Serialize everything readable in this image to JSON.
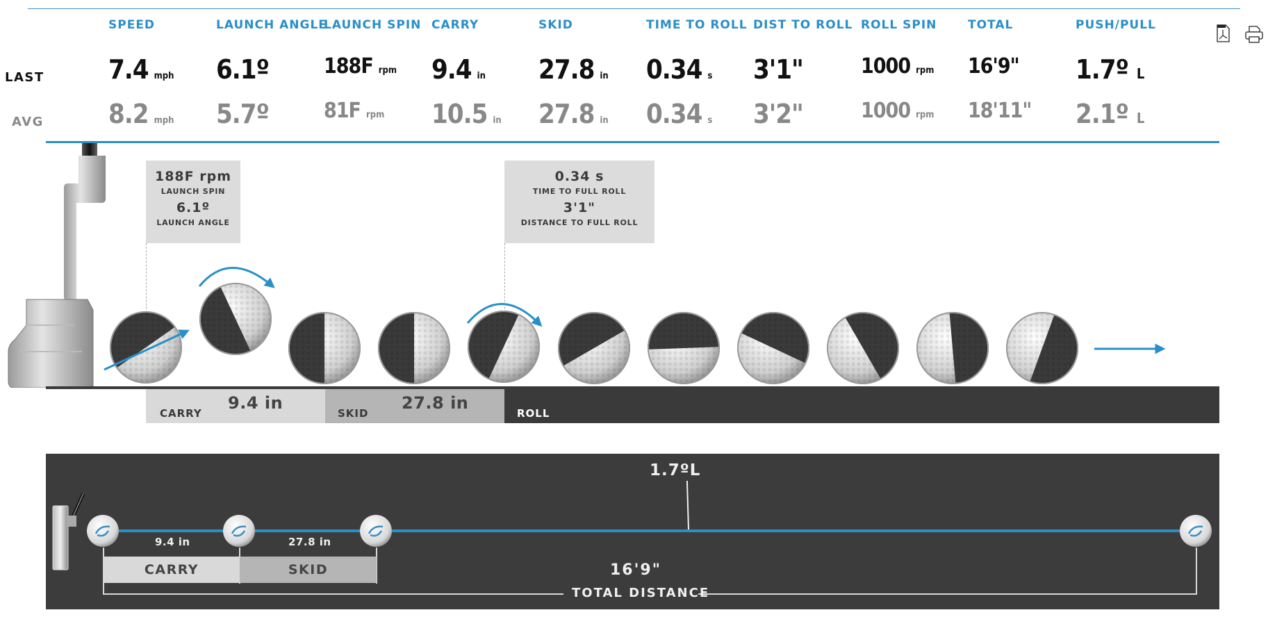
{
  "header": {
    "columns": [
      {
        "label": "SPEED",
        "last": "7.4",
        "last_unit": "mph",
        "avg": "8.2",
        "avg_unit": "mph"
      },
      {
        "label": "LAUNCH ANGLE",
        "last": "6.1º",
        "last_unit": "",
        "avg": "5.7º",
        "avg_unit": ""
      },
      {
        "label": "LAUNCH SPIN",
        "last": "188F",
        "last_unit": "rpm",
        "avg": "81F",
        "avg_unit": "rpm"
      },
      {
        "label": "CARRY",
        "last": "9.4",
        "last_unit": "in",
        "avg": "10.5",
        "avg_unit": "in"
      },
      {
        "label": "SKID",
        "last": "27.8",
        "last_unit": "in",
        "avg": "27.8",
        "avg_unit": "in"
      },
      {
        "label": "TIME TO ROLL",
        "last": "0.34",
        "last_unit": "s",
        "avg": "0.34",
        "avg_unit": "s"
      },
      {
        "label": "DIST TO ROLL",
        "last": "3'1\"",
        "last_unit": "",
        "avg": "3'2\"",
        "avg_unit": ""
      },
      {
        "label": "ROLL SPIN",
        "last": "1000",
        "last_unit": "rpm",
        "avg": "1000",
        "avg_unit": "rpm"
      },
      {
        "label": "TOTAL",
        "last": "16'9\"",
        "last_unit": "",
        "avg": "18'11\"",
        "avg_unit": ""
      },
      {
        "label": "PUSH/PULL",
        "last": "1.7º",
        "last_unit": "L",
        "avg": "2.1º",
        "avg_unit": "L"
      }
    ],
    "row_last": "LAST",
    "row_avg": "AVG",
    "icons": [
      "pdf-export-icon",
      "print-icon"
    ]
  },
  "side_view": {
    "launch_callout": {
      "value1": "188F rpm",
      "label1": "LAUNCH SPIN",
      "value2": "6.1º",
      "label2": "LAUNCH ANGLE"
    },
    "roll_callout": {
      "value1": "0.34 s",
      "label1": "TIME TO FULL ROLL",
      "value2": "3'1\"",
      "label2": "DISTANCE TO FULL ROLL"
    },
    "segments": {
      "carry_label": "CARRY",
      "carry_value": "9.4 in",
      "skid_label": "SKID",
      "skid_value": "27.8 in",
      "roll_label": "ROLL"
    },
    "ball_rotations_deg": [
      55,
      -25,
      0,
      0,
      25,
      60,
      88,
      115,
      150,
      175,
      200
    ]
  },
  "top_view": {
    "push_pull": "1.7ºL",
    "carry_value": "9.4 in",
    "skid_value": "27.8 in",
    "carry_label": "CARRY",
    "skid_label": "SKID",
    "total_value": "16'9\"",
    "total_label": "TOTAL DISTANCE"
  },
  "colors": {
    "accent": "#2a8fc8",
    "dark_band": "#3a3a3a",
    "carry": "#d9d9d9",
    "skid": "#b5b5b5"
  }
}
